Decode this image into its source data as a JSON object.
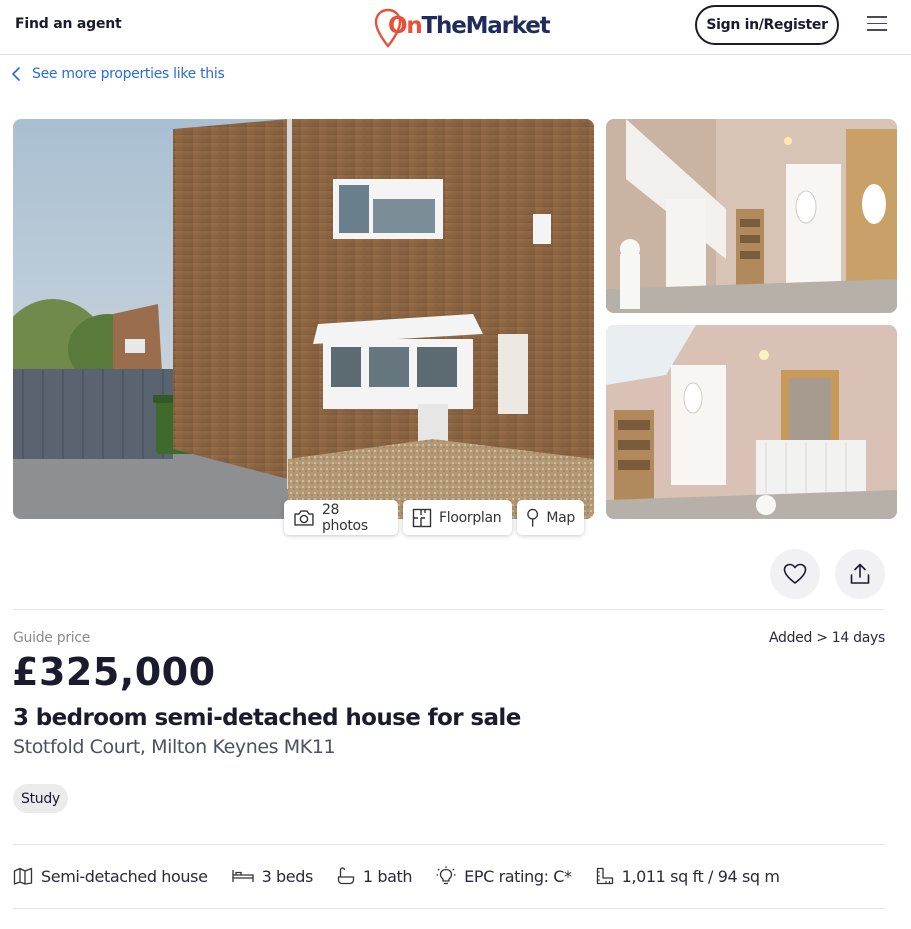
{
  "header": {
    "find_agent": "Find an agent",
    "logo_on": "On",
    "logo_rest": "TheMarket",
    "sign_in": "Sign in/Register"
  },
  "breadcrumb": {
    "back_label": "See more properties like this"
  },
  "gallery": {
    "photos_label": "28 photos",
    "floorplan_label": "Floorplan",
    "map_label": "Map"
  },
  "listing": {
    "price_qualifier": "Guide price",
    "added": "Added > 14 days",
    "price": "£325,000",
    "title": "3 bedroom semi-detached house for sale",
    "address": "Stotfold Court, Milton Keynes MK11",
    "tags": [
      "Study"
    ]
  },
  "features": {
    "type": "Semi-detached house",
    "beds": "3 beds",
    "baths": "1 bath",
    "epc": "EPC rating: C*",
    "size": "1,011 sq ft / 94 sq m"
  },
  "icons": {
    "menu": "hamburger-menu-icon",
    "back": "chevron-left-icon",
    "photos": "camera-icon",
    "floorplan": "floorplan-icon",
    "map": "map-pin-icon",
    "save": "heart-icon",
    "share": "share-icon",
    "type": "house-icon",
    "beds": "bed-icon",
    "baths": "bath-icon",
    "epc": "lightbulb-icon",
    "size": "area-icon"
  },
  "colors": {
    "brand_red": "#e8503a",
    "brand_navy": "#1f2c5c",
    "link_blue": "#2a6cd6",
    "text_dark": "#1b1b2f"
  }
}
